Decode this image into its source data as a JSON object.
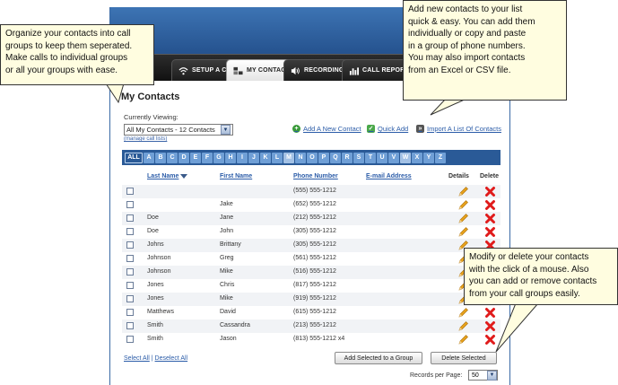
{
  "callouts": {
    "left": [
      "Organize your contacts into call",
      "groups to keep them seperated.",
      "Make calls to individual groups",
      "or all your groups with ease."
    ],
    "top_right": [
      "Add new contacts to your list",
      "quick & easy.  You can add them",
      "individually or copy and paste",
      "in a group of phone numbers.",
      "You may also import contacts",
      "from an Excel or CSV file."
    ],
    "bottom_right": [
      "Modify or delete your contacts",
      "with the click of a mouse.  Also",
      "you can add or remove contacts",
      "from your call groups easily."
    ]
  },
  "nav": {
    "tabs": [
      {
        "label": "SETUP A CALL",
        "icon": "wifi-icon"
      },
      {
        "label": "MY CONTACTS",
        "icon": "contacts-icon"
      },
      {
        "label": "RECORDINGS",
        "icon": "speaker-icon"
      },
      {
        "label": "CALL REPORTS",
        "icon": "bar-chart-icon"
      }
    ]
  },
  "page": {
    "title": "My Contacts",
    "currently_viewing_label": "Currently Viewing:",
    "group_select_value": "All My Contacts - 12 Contacts",
    "manage_link": "(manage call lists)",
    "actions": {
      "add_new": "Add A New Contact",
      "quick_add": "Quick Add",
      "import": "Import A List Of Contacts"
    }
  },
  "alphabet": [
    "ALL",
    "A",
    "B",
    "C",
    "D",
    "E",
    "F",
    "G",
    "H",
    "I",
    "J",
    "K",
    "L",
    "M",
    "N",
    "O",
    "P",
    "Q",
    "R",
    "S",
    "T",
    "U",
    "V",
    "W",
    "X",
    "Y",
    "Z"
  ],
  "table": {
    "headers": {
      "last_name": "Last Name",
      "first_name": "First Name",
      "phone": "Phone Number",
      "email": "E-mail Address",
      "details": "Details",
      "delete": "Delete"
    },
    "rows": [
      {
        "last": "",
        "first": "",
        "phone": "(555) 555-1212",
        "email": ""
      },
      {
        "last": "",
        "first": "Jake",
        "phone": "(652) 555-1212",
        "email": ""
      },
      {
        "last": "Doe",
        "first": "Jane",
        "phone": "(212) 555-1212",
        "email": ""
      },
      {
        "last": "Doe",
        "first": "John",
        "phone": "(305) 555-1212",
        "email": ""
      },
      {
        "last": "Johns",
        "first": "Brittany",
        "phone": "(305) 555-1212",
        "email": ""
      },
      {
        "last": "Johnson",
        "first": "Greg",
        "phone": "(561) 555-1212",
        "email": ""
      },
      {
        "last": "Johnson",
        "first": "Mike",
        "phone": "(516) 555-1212",
        "email": ""
      },
      {
        "last": "Jones",
        "first": "Chris",
        "phone": "(817) 555-1212",
        "email": ""
      },
      {
        "last": "Jones",
        "first": "Mike",
        "phone": "(919) 555-1212",
        "email": ""
      },
      {
        "last": "Matthews",
        "first": "David",
        "phone": "(615) 555-1212",
        "email": ""
      },
      {
        "last": "Smith",
        "first": "Cassandra",
        "phone": "(213) 555-1212",
        "email": ""
      },
      {
        "last": "Smith",
        "first": "Jason",
        "phone": "(813) 555-1212  x4",
        "email": ""
      }
    ]
  },
  "footer": {
    "select_all": "Select All",
    "separator": "|",
    "deselect_all": "Deselect All",
    "add_to_group_button": "Add Selected to a Group",
    "delete_selected_button": "Delete Selected",
    "records_per_page_label": "Records per Page:",
    "records_per_page_value": "50"
  },
  "colors": {
    "brand_blue": "#2a5a97",
    "link_blue": "#2b5ca8",
    "callout_bg": "#fffde0",
    "delete_red": "#e01b1b",
    "pencil_orange": "#e8a21c"
  }
}
